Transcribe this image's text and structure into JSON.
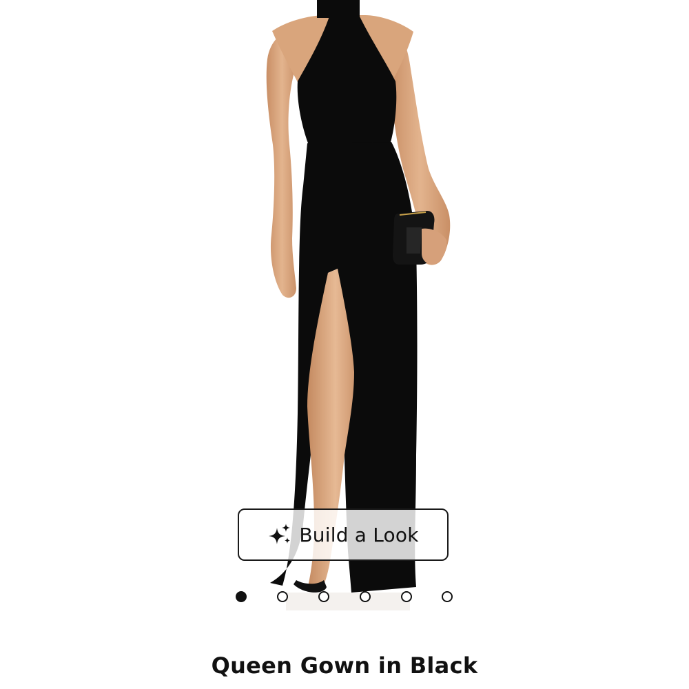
{
  "product": {
    "title": "Queen Gown in Black",
    "image_alt": "Model wearing black halter-neck gown with thigh slit, holding black clutch"
  },
  "build_look": {
    "label": "Build a Look",
    "icon": "sparkle-icon"
  },
  "carousel": {
    "count": 6,
    "active_index": 0
  },
  "colors": {
    "dress": "#0b0b0b",
    "skin": "#d9a77f",
    "text": "#111111",
    "background": "#ffffff"
  }
}
